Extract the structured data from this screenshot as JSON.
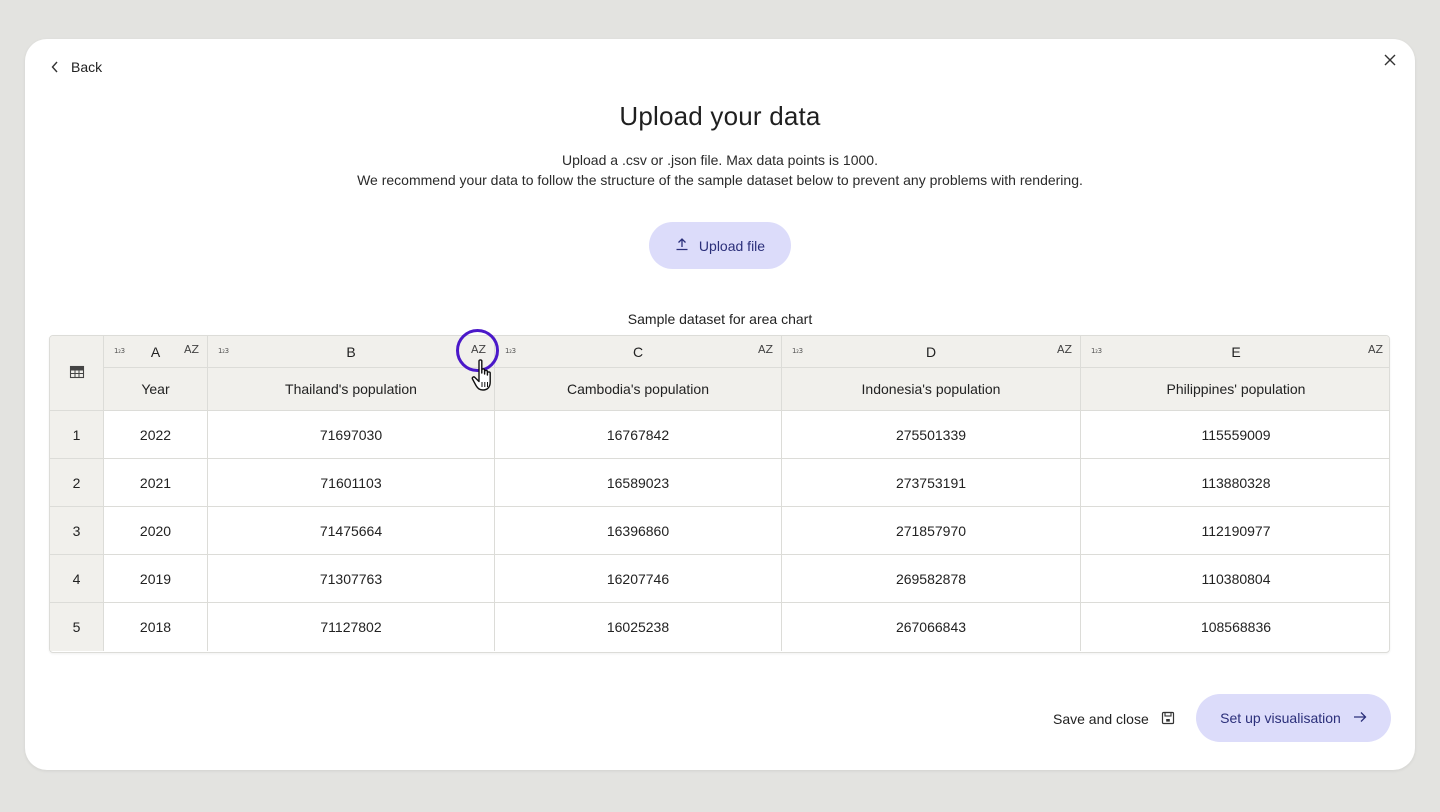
{
  "nav": {
    "back_label": "Back"
  },
  "header": {
    "title": "Upload your data",
    "subtitle_line1": "Upload a .csv or .json file. Max data points is 1000.",
    "subtitle_line2": "We recommend your data to follow the structure of the sample dataset below to prevent any problems with rendering."
  },
  "upload": {
    "label": "Upload file"
  },
  "table": {
    "caption": "Sample dataset for area chart",
    "type_icon_text": "1₂3",
    "sort_icon_text": "AZ",
    "column_letters": [
      "A",
      "B",
      "C",
      "D",
      "E"
    ],
    "column_headers": [
      "Year",
      "Thailand's population",
      "Cambodia's population",
      "Indonesia's population",
      "Philippines' population"
    ],
    "rows": [
      {
        "num": "1",
        "cells": [
          "2022",
          "71697030",
          "16767842",
          "275501339",
          "115559009"
        ]
      },
      {
        "num": "2",
        "cells": [
          "2021",
          "71601103",
          "16589023",
          "273753191",
          "113880328"
        ]
      },
      {
        "num": "3",
        "cells": [
          "2020",
          "71475664",
          "16396860",
          "271857970",
          "112190977"
        ]
      },
      {
        "num": "4",
        "cells": [
          "2019",
          "71307763",
          "16207746",
          "269582878",
          "110380804"
        ]
      },
      {
        "num": "5",
        "cells": [
          "2018",
          "71127802",
          "16025238",
          "267066843",
          "108568836"
        ]
      }
    ]
  },
  "footer": {
    "save_label": "Save and close",
    "setup_label": "Set up visualisation"
  },
  "colors": {
    "accent_button": "#dcdcfa",
    "accent_text": "#2b2f7a",
    "highlight_ring": "#4a18c9",
    "header_bg": "#f1f0ec"
  }
}
